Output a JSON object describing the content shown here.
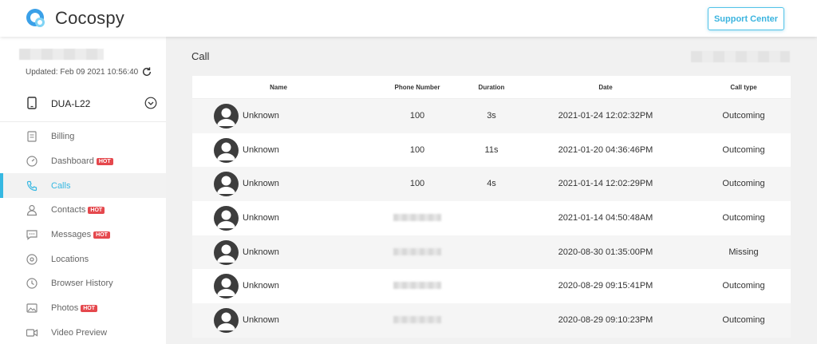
{
  "app": {
    "name": "Cocospy",
    "support_label": "Support Center"
  },
  "sidebar": {
    "updated": "Updated: Feb 09 2021 10:56:40",
    "device_name": "DUA-L22",
    "items": [
      {
        "label": "Billing",
        "icon": "billing-icon",
        "hot": ""
      },
      {
        "label": "Dashboard",
        "icon": "dashboard-icon",
        "hot": "HOT"
      },
      {
        "label": "Calls",
        "icon": "phone-icon",
        "hot": "",
        "active": true
      },
      {
        "label": "Contacts",
        "icon": "contacts-icon",
        "hot": "HOT"
      },
      {
        "label": "Messages",
        "icon": "messages-icon",
        "hot": "HOT"
      },
      {
        "label": "Locations",
        "icon": "location-icon",
        "hot": ""
      },
      {
        "label": "Browser History",
        "icon": "history-icon",
        "hot": ""
      },
      {
        "label": "Photos",
        "icon": "photos-icon",
        "hot": "HOT"
      },
      {
        "label": "Video Preview",
        "icon": "video-icon",
        "hot": ""
      }
    ]
  },
  "main": {
    "title": "Call",
    "columns": [
      "Name",
      "Phone Number",
      "Duration",
      "Date",
      "Call type"
    ],
    "rows": [
      {
        "name": "Unknown",
        "phone": "100",
        "duration": "3s",
        "date": "2021-01-24 12:02:32PM",
        "type": "Outcoming"
      },
      {
        "name": "Unknown",
        "phone": "100",
        "duration": "11s",
        "date": "2021-01-20 04:36:46PM",
        "type": "Outcoming"
      },
      {
        "name": "Unknown",
        "phone": "100",
        "duration": "4s",
        "date": "2021-01-14 12:02:29PM",
        "type": "Outcoming"
      },
      {
        "name": "Unknown",
        "phone": "",
        "duration": "",
        "date": "2021-01-14 04:50:48AM",
        "type": "Outcoming"
      },
      {
        "name": "Unknown",
        "phone": "",
        "duration": "",
        "date": "2020-08-30 01:35:00PM",
        "type": "Missing"
      },
      {
        "name": "Unknown",
        "phone": "",
        "duration": "",
        "date": "2020-08-29 09:15:41PM",
        "type": "Outcoming"
      },
      {
        "name": "Unknown",
        "phone": "",
        "duration": "",
        "date": "2020-08-29 09:10:23PM",
        "type": "Outcoming"
      }
    ]
  },
  "colors": {
    "accent": "#36b8e2",
    "hot": "#e5484d"
  }
}
